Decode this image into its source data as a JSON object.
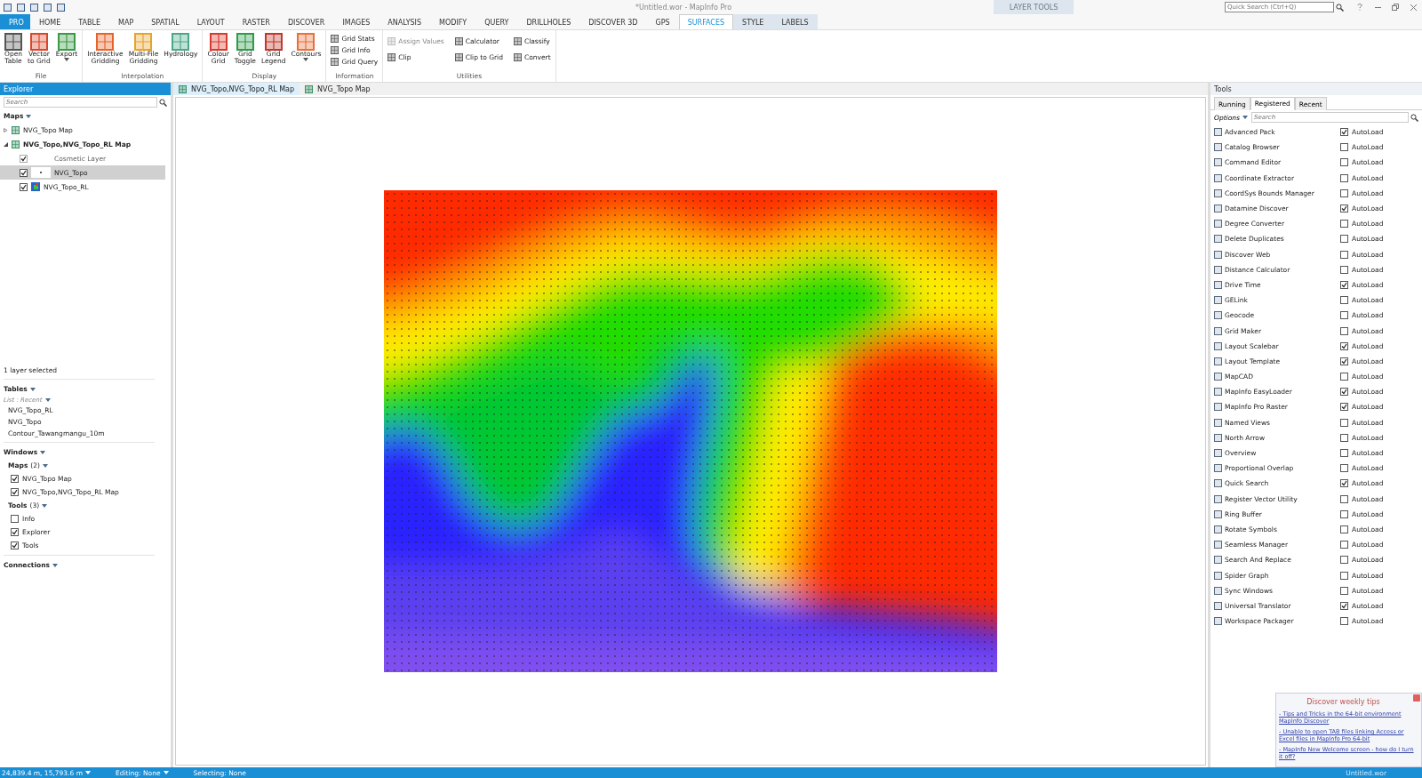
{
  "title_bar": {
    "title": "*Untitled.wor - MapInfo Pro",
    "context_group": "LAYER TOOLS",
    "quick_search": {
      "placeholder": "Quick Search (Ctrl+Q)"
    }
  },
  "ribbon_tabs": [
    {
      "label": "PRO",
      "kind": "file",
      "selected": false
    },
    {
      "label": "HOME",
      "kind": "tab",
      "selected": false
    },
    {
      "label": "TABLE",
      "kind": "tab",
      "selected": false
    },
    {
      "label": "MAP",
      "kind": "tab",
      "selected": false
    },
    {
      "label": "SPATIAL",
      "kind": "tab",
      "selected": false
    },
    {
      "label": "LAYOUT",
      "kind": "tab",
      "selected": false
    },
    {
      "label": "RASTER",
      "kind": "tab",
      "selected": false
    },
    {
      "label": "DISCOVER",
      "kind": "tab",
      "selected": false
    },
    {
      "label": "IMAGES",
      "kind": "tab",
      "selected": false
    },
    {
      "label": "ANALYSIS",
      "kind": "tab",
      "selected": false
    },
    {
      "label": "MODIFY",
      "kind": "tab",
      "selected": false
    },
    {
      "label": "QUERY",
      "kind": "tab",
      "selected": false
    },
    {
      "label": "DRILLHOLES",
      "kind": "tab",
      "selected": false
    },
    {
      "label": "DISCOVER 3D",
      "kind": "tab",
      "selected": false
    },
    {
      "label": "GPS",
      "kind": "tab",
      "selected": false
    },
    {
      "label": "SURFACES",
      "kind": "context",
      "selected": true
    },
    {
      "label": "STYLE",
      "kind": "context",
      "selected": false
    },
    {
      "label": "LABELS",
      "kind": "context",
      "selected": false
    }
  ],
  "ribbon_groups": [
    {
      "label": "File",
      "buttons": [
        {
          "label": "Open\nTable",
          "kind": "large"
        },
        {
          "label": "Vector\nto Grid",
          "kind": "large"
        },
        {
          "label": "Export",
          "kind": "large",
          "caret": true
        }
      ]
    },
    {
      "label": "Interpolation",
      "buttons": [
        {
          "label": "Interactive\nGridding",
          "kind": "large"
        },
        {
          "label": "Multi-File\nGridding",
          "kind": "large"
        },
        {
          "label": "Hydrology",
          "kind": "large"
        }
      ]
    },
    {
      "label": "Display",
      "buttons": [
        {
          "label": "Colour\nGrid",
          "kind": "large"
        },
        {
          "label": "Grid\nToggle",
          "kind": "large"
        },
        {
          "label": "Grid\nLegend",
          "kind": "large"
        },
        {
          "label": "Contours",
          "kind": "large",
          "caret": true
        }
      ]
    },
    {
      "label": "Information",
      "buttons": [
        {
          "label": "Grid Stats",
          "kind": "small",
          "disabled": false
        },
        {
          "label": "Grid Info",
          "kind": "small",
          "disabled": false
        },
        {
          "label": "Grid Query",
          "kind": "small",
          "disabled": false
        }
      ]
    },
    {
      "label": "Utilities",
      "buttons": [
        {
          "label": "Assign Values",
          "kind": "small",
          "disabled": true
        },
        {
          "label": "Clip",
          "kind": "small",
          "disabled": false
        },
        {
          "label": "Calculator",
          "kind": "small",
          "disabled": false
        },
        {
          "label": "Clip to Grid",
          "kind": "small",
          "disabled": false
        },
        {
          "label": "Classify",
          "kind": "small",
          "disabled": false
        },
        {
          "label": "Convert",
          "kind": "small",
          "disabled": false
        }
      ]
    }
  ],
  "explorer": {
    "title": "Explorer",
    "search": {
      "placeholder": "Search"
    },
    "maps_heading": "Maps",
    "maps": [
      {
        "label": "NVG_Topo Map",
        "expanded": false
      },
      {
        "label": "NVG_Topo,NVG_Topo_RL Map",
        "expanded": true,
        "children": [
          {
            "label": "Cosmetic Layer",
            "checked": true,
            "disabled": true,
            "selected": false,
            "kind": "cosmetic"
          },
          {
            "label": "NVG_Topo",
            "checked": true,
            "disabled": false,
            "selected": true,
            "kind": "points"
          },
          {
            "label": "NVG_Topo_RL",
            "checked": true,
            "disabled": false,
            "selected": false,
            "kind": "raster"
          }
        ]
      }
    ],
    "selection_note": "1 layer selected",
    "tables_heading": "Tables",
    "tables_filter": "List : Recent",
    "tables": [
      "NVG_Topo_RL",
      "NVG_Topo",
      "Contour_Tawangmangu_10m"
    ],
    "windows_heading": "Windows",
    "window_groups": [
      {
        "label": "Maps",
        "count": "(2)",
        "items": [
          {
            "label": "NVG_Topo Map",
            "checked": true
          },
          {
            "label": "NVG_Topo,NVG_Topo_RL Map",
            "checked": true
          }
        ]
      },
      {
        "label": "Tools",
        "count": "(3)",
        "items": [
          {
            "label": "Info",
            "checked": false
          },
          {
            "label": "Explorer",
            "checked": true
          },
          {
            "label": "Tools",
            "checked": true
          }
        ]
      }
    ],
    "connections_heading": "Connections"
  },
  "document_tabs": [
    {
      "label": "NVG_Topo,NVG_Topo_RL Map",
      "selected": true
    },
    {
      "label": "NVG_Topo Map",
      "selected": false
    }
  ],
  "tools_panel": {
    "title": "Tools",
    "tabs": [
      {
        "label": "Running",
        "selected": false
      },
      {
        "label": "Registered",
        "selected": true
      },
      {
        "label": "Recent",
        "selected": false
      }
    ],
    "options": "Options",
    "search": {
      "placeholder": "Search"
    },
    "tools": [
      {
        "name": "Advanced Pack",
        "autoload": true,
        "label": "AutoLoad"
      },
      {
        "name": "Catalog Browser",
        "autoload": false,
        "label": "AutoLoad"
      },
      {
        "name": "Command Editor",
        "autoload": false,
        "label": "AutoLoad"
      },
      {
        "name": "Coordinate Extractor",
        "autoload": false,
        "label": "AutoLoad"
      },
      {
        "name": "CoordSys Bounds Manager",
        "autoload": false,
        "label": "AutoLoad"
      },
      {
        "name": "Datamine Discover",
        "autoload": true,
        "label": "AutoLoad"
      },
      {
        "name": "Degree Converter",
        "autoload": false,
        "label": "AutoLoad"
      },
      {
        "name": "Delete Duplicates",
        "autoload": false,
        "label": "AutoLoad"
      },
      {
        "name": "Discover Web",
        "autoload": false,
        "label": "AutoLoad"
      },
      {
        "name": "Distance Calculator",
        "autoload": false,
        "label": "AutoLoad"
      },
      {
        "name": "Drive Time",
        "autoload": true,
        "label": "AutoLoad"
      },
      {
        "name": "GELink",
        "autoload": false,
        "label": "AutoLoad"
      },
      {
        "name": "Geocode",
        "autoload": false,
        "label": "AutoLoad"
      },
      {
        "name": "Grid Maker",
        "autoload": false,
        "label": "AutoLoad"
      },
      {
        "name": "Layout Scalebar",
        "autoload": true,
        "label": "AutoLoad"
      },
      {
        "name": "Layout Template",
        "autoload": true,
        "label": "AutoLoad"
      },
      {
        "name": "MapCAD",
        "autoload": false,
        "label": "AutoLoad"
      },
      {
        "name": "MapInfo EasyLoader",
        "autoload": true,
        "label": "AutoLoad"
      },
      {
        "name": "MapInfo Pro Raster",
        "autoload": true,
        "label": "AutoLoad"
      },
      {
        "name": "Named Views",
        "autoload": false,
        "label": "AutoLoad"
      },
      {
        "name": "North Arrow",
        "autoload": false,
        "label": "AutoLoad"
      },
      {
        "name": "Overview",
        "autoload": false,
        "label": "AutoLoad"
      },
      {
        "name": "Proportional Overlap",
        "autoload": false,
        "label": "AutoLoad"
      },
      {
        "name": "Quick Search",
        "autoload": true,
        "label": "AutoLoad"
      },
      {
        "name": "Register Vector Utility",
        "autoload": false,
        "label": "AutoLoad"
      },
      {
        "name": "Ring Buffer",
        "autoload": false,
        "label": "AutoLoad"
      },
      {
        "name": "Rotate Symbols",
        "autoload": false,
        "label": "AutoLoad"
      },
      {
        "name": "Seamless Manager",
        "autoload": false,
        "label": "AutoLoad"
      },
      {
        "name": "Search And Replace",
        "autoload": false,
        "label": "AutoLoad"
      },
      {
        "name": "Spider Graph",
        "autoload": false,
        "label": "AutoLoad"
      },
      {
        "name": "Sync Windows",
        "autoload": false,
        "label": "AutoLoad"
      },
      {
        "name": "Universal Translator",
        "autoload": true,
        "label": "AutoLoad"
      },
      {
        "name": "Workspace Packager",
        "autoload": false,
        "label": "AutoLoad"
      }
    ]
  },
  "tips": {
    "title": "Discover weekly tips",
    "links": [
      "- Tips and Tricks in the 64-bit environment MapInfo Discover",
      "- Unable to open TAB files linking Access or Excel files in MapInfo Pro 64-bit",
      "- MapInfo New Welcome screen - how do I turn it off?"
    ]
  },
  "status_bar": {
    "coordinates": "24,839.4 m, 15,793.6 m",
    "editing": "Editing: None",
    "selecting": "Selecting: None",
    "workspace": "Untitled.wor"
  }
}
